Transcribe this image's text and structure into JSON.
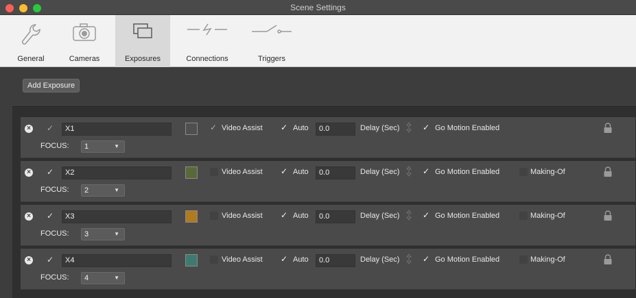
{
  "window": {
    "title": "Scene Settings"
  },
  "toolbar": {
    "items": [
      {
        "label": "General",
        "icon": "wrench-icon"
      },
      {
        "label": "Cameras",
        "icon": "camera-icon"
      },
      {
        "label": "Exposures",
        "icon": "exposures-icon",
        "selected": true
      },
      {
        "label": "Connections",
        "icon": "lightning-icon"
      },
      {
        "label": "Triggers",
        "icon": "switch-icon"
      }
    ]
  },
  "content": {
    "add_button": "Add Exposure",
    "labels": {
      "focus": "FOCUS:",
      "video_assist": "Video Assist",
      "auto": "Auto",
      "delay": "Delay (Sec)",
      "go_motion": "Go Motion Enabled",
      "making_of": "Making-Of"
    },
    "checkmark": "✓",
    "remove_glyph": "×",
    "exposures": [
      {
        "name": "X1",
        "focus": "1",
        "color": "#4f4f4f",
        "enabled_dim": true,
        "video_assist": true,
        "auto": true,
        "delay": "0.0",
        "go_motion": true,
        "making_of_visible": false,
        "making_of": false
      },
      {
        "name": "X2",
        "focus": "2",
        "color": "#59693a",
        "enabled_dim": false,
        "video_assist": false,
        "auto": true,
        "delay": "0.0",
        "go_motion": true,
        "making_of_visible": true,
        "making_of": false
      },
      {
        "name": "X3",
        "focus": "3",
        "color": "#b07a1e",
        "enabled_dim": false,
        "video_assist": false,
        "auto": true,
        "delay": "0.0",
        "go_motion": true,
        "making_of_visible": true,
        "making_of": false
      },
      {
        "name": "X4",
        "focus": "4",
        "color": "#3d7b72",
        "enabled_dim": false,
        "video_assist": false,
        "auto": true,
        "delay": "0.0",
        "go_motion": true,
        "making_of_visible": true,
        "making_of": false
      }
    ]
  }
}
